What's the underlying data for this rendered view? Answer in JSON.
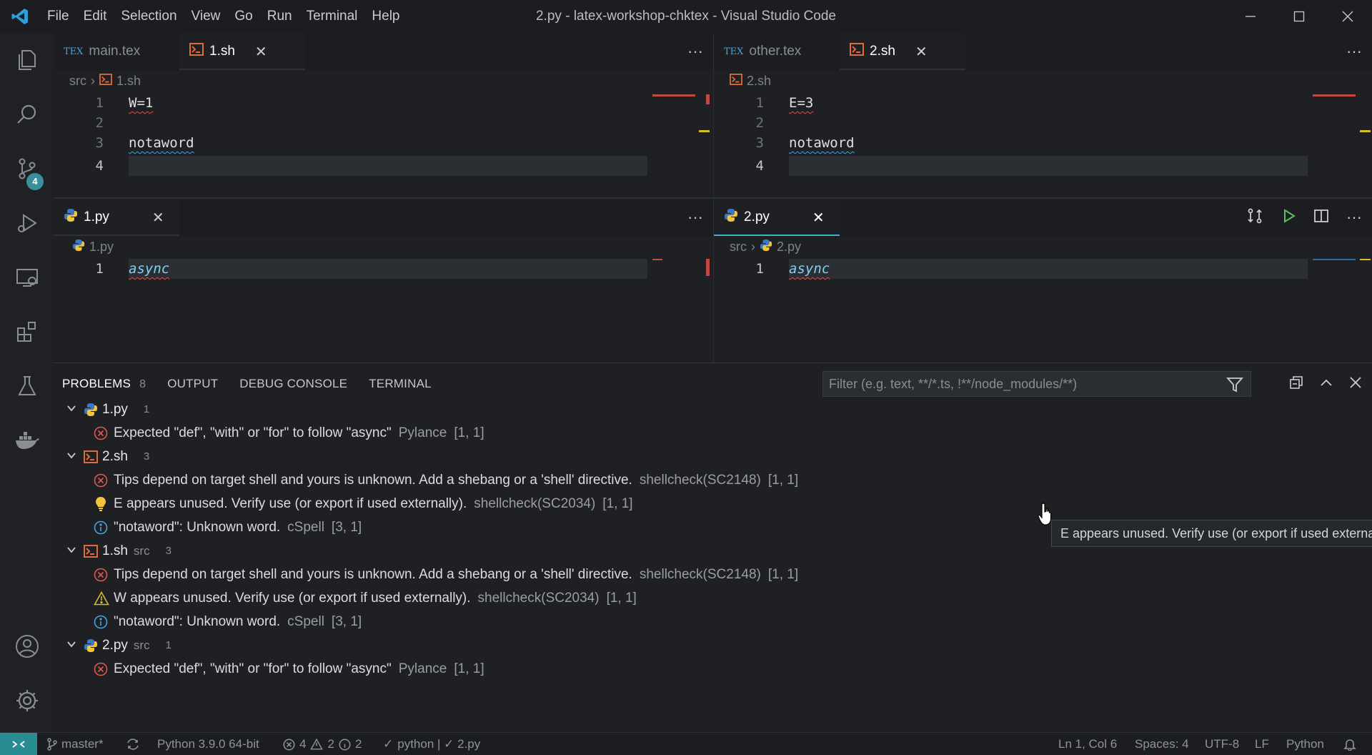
{
  "window": {
    "title": "2.py - latex-workshop-chktex - Visual Studio Code",
    "menu": [
      "File",
      "Edit",
      "Selection",
      "View",
      "Go",
      "Run",
      "Terminal",
      "Help"
    ]
  },
  "activity": {
    "scm_badge": "4"
  },
  "editors": {
    "top_left": {
      "tabs": [
        {
          "label": "main.tex",
          "icon": "tex"
        },
        {
          "label": "1.sh",
          "icon": "shell"
        }
      ],
      "breadcrumb": [
        "src",
        "1.sh"
      ],
      "lines": [
        {
          "num": "1",
          "text": "W=1"
        },
        {
          "num": "2",
          "text": ""
        },
        {
          "num": "3",
          "text": "notaword"
        },
        {
          "num": "4",
          "text": ""
        }
      ]
    },
    "top_right": {
      "tabs": [
        {
          "label": "other.tex",
          "icon": "tex"
        },
        {
          "label": "2.sh",
          "icon": "shell"
        }
      ],
      "breadcrumb": [
        "2.sh"
      ],
      "lines": [
        {
          "num": "1",
          "text": "E=3"
        },
        {
          "num": "2",
          "text": ""
        },
        {
          "num": "3",
          "text": "notaword"
        },
        {
          "num": "4",
          "text": ""
        }
      ]
    },
    "bottom_left": {
      "tabs": [
        {
          "label": "1.py",
          "icon": "python"
        }
      ],
      "breadcrumb": [
        "1.py"
      ],
      "lines": [
        {
          "num": "1",
          "text": "async"
        }
      ]
    },
    "bottom_right": {
      "tabs": [
        {
          "label": "2.py",
          "icon": "python"
        }
      ],
      "breadcrumb": [
        "src",
        "2.py"
      ],
      "lines": [
        {
          "num": "1",
          "text": "async"
        }
      ]
    }
  },
  "panel": {
    "tabs": {
      "problems": "PROBLEMS",
      "problems_count": "8",
      "output": "OUTPUT",
      "debug_console": "DEBUG CONSOLE",
      "terminal": "TERMINAL"
    },
    "filter_placeholder": "Filter (e.g. text, **/*.ts, !**/node_modules/**)",
    "groups": [
      {
        "file": "1.py",
        "dir": "",
        "count": "1",
        "icon": "python",
        "items": [
          {
            "severity": "error",
            "message": "Expected \"def\", \"with\" or \"for\" to follow \"async\"",
            "source": "Pylance",
            "loc": "[1, 1]"
          }
        ]
      },
      {
        "file": "2.sh",
        "dir": "",
        "count": "3",
        "icon": "shell",
        "items": [
          {
            "severity": "error",
            "message": "Tips depend on target shell and yours is unknown. Add a shebang or a 'shell' directive.",
            "source": "shellcheck(SC2148)",
            "loc": "[1, 1]"
          },
          {
            "severity": "bulb",
            "message": "E appears unused. Verify use (or export if used externally).",
            "source": "shellcheck(SC2034)",
            "loc": "[1, 1]"
          },
          {
            "severity": "info",
            "message": "\"notaword\": Unknown word.",
            "source": "cSpell",
            "loc": "[3, 1]"
          }
        ]
      },
      {
        "file": "1.sh",
        "dir": "src",
        "count": "3",
        "icon": "shell",
        "items": [
          {
            "severity": "error",
            "message": "Tips depend on target shell and yours is unknown. Add a shebang or a 'shell' directive.",
            "source": "shellcheck(SC2148)",
            "loc": "[1, 1]"
          },
          {
            "severity": "warning",
            "message": "W appears unused. Verify use (or export if used externally).",
            "source": "shellcheck(SC2034)",
            "loc": "[1, 1]"
          },
          {
            "severity": "info",
            "message": "\"notaword\": Unknown word.",
            "source": "cSpell",
            "loc": "[3, 1]"
          }
        ]
      },
      {
        "file": "2.py",
        "dir": "src",
        "count": "1",
        "icon": "python",
        "items": [
          {
            "severity": "error",
            "message": "Expected \"def\", \"with\" or \"for\" to follow \"async\"",
            "source": "Pylance",
            "loc": "[1, 1]"
          }
        ]
      }
    ]
  },
  "tooltip": "E appears unused. Verify use (or export if used externally)",
  "statusbar": {
    "branch": "master*",
    "interpreter": "Python 3.9.0 64-bit",
    "errors": "4",
    "warnings": "2",
    "infos": "2",
    "checks": "python | ✓ 2.py",
    "position": "Ln 1, Col 6",
    "spaces": "Spaces: 4",
    "encoding": "UTF-8",
    "eol": "LF",
    "language": "Python"
  },
  "colors": {
    "accent": "#3fb3c7",
    "error": "#e0584f",
    "warning": "#d7ba2e",
    "info": "#4aa3d8",
    "remote": "#2a8c93"
  }
}
